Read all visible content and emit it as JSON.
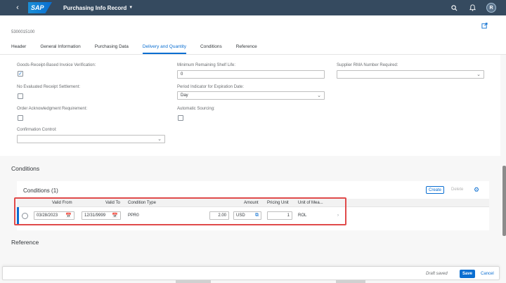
{
  "shell": {
    "title": "Purchasing Info Record",
    "logo_text": "SAP",
    "avatar_initial": "R",
    "icons": [
      "back-icon",
      "search-icon",
      "bell-icon",
      "user-avatar"
    ]
  },
  "header": {
    "object_id": "5300015100",
    "tabs": [
      "Header",
      "General Information",
      "Purchasing Data",
      "Delivery and Quantity",
      "Conditions",
      "Reference"
    ],
    "active_tab": "Delivery and Quantity"
  },
  "form": {
    "gr_based_iv_label": "Goods-Receipt-Based Invoice Verification:",
    "gr_based_iv_checked": true,
    "no_ers_label": "No Evaluated Receipt Settlement:",
    "order_ack_label": "Order Acknowledgment Requirement:",
    "confirmation_control_label": "Confirmation Control:",
    "confirmation_control_value": "",
    "min_shelf_life_label": "Minimum Remaining Shelf Life:",
    "min_shelf_life_value": "0",
    "period_indicator_label": "Period Indicator for Expiration Date:",
    "period_indicator_value": "Day",
    "auto_sourcing_label": "Automatic Sourcing:",
    "supplier_rma_label": "Supplier RMA Number Required:",
    "supplier_rma_value": ""
  },
  "conditions": {
    "section_title": "Conditions",
    "table_title": "Conditions (1)",
    "create_label": "Create",
    "delete_label": "Delete",
    "columns": [
      "Valid From",
      "Valid To",
      "Condition Type",
      "Amount",
      "Pricing Unit",
      "Unit of Mea..."
    ],
    "rows": [
      {
        "valid_from": "03/28/2023",
        "valid_to": "12/31/9999",
        "condition_type": "PPR0",
        "amount": "2.00",
        "currency": "USD",
        "pricing_unit": "1",
        "unit": "ROL"
      }
    ]
  },
  "reference": {
    "section_title": "Reference"
  },
  "footer": {
    "draft_status": "Draft saved",
    "save_label": "Save",
    "cancel_label": "Cancel"
  },
  "colors": {
    "shell": "#354a5f",
    "accent": "#0a6ed1",
    "highlight": "#e04a4a"
  }
}
